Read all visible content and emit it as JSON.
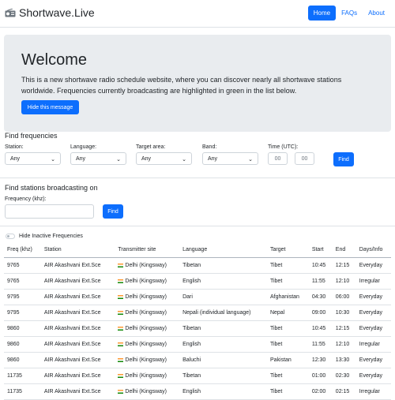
{
  "nav": {
    "brand": "Shortwave.Live",
    "links": [
      {
        "label": "Home",
        "active": true
      },
      {
        "label": "FAQs",
        "active": false
      },
      {
        "label": "About",
        "active": false
      }
    ]
  },
  "hero": {
    "title": "Welcome",
    "text": "This is a new shortwave radio schedule website, where you can discover nearly all shortwave stations worldwide. Frequencies currently broadcasting are highlighted in green in the list below.",
    "button": "Hide this message"
  },
  "find_frequencies": {
    "title": "Find frequencies",
    "station_label": "Station:",
    "station_value": "Any",
    "language_label": "Language:",
    "language_value": "Any",
    "target_label": "Target area:",
    "target_value": "Any",
    "band_label": "Band:",
    "band_value": "Any",
    "time_label": "Time (UTC):",
    "hour_placeholder": "00",
    "minute_placeholder": "00",
    "find_button": "Find"
  },
  "find_stations": {
    "title": "Find stations broadcasting on",
    "freq_label": "Frequency (khz):",
    "freq_value": "",
    "find_button": "Find"
  },
  "toggle": {
    "label": "Hide Inactive Frequencies",
    "on": false
  },
  "table": {
    "headers": [
      "Freq (khz)",
      "Station",
      "Transmitter site",
      "Language",
      "Target",
      "Start",
      "End",
      "Days/Info"
    ],
    "rows": [
      [
        "9765",
        "AIR Akashvani Ext.Sce",
        "Delhi (Kingsway)",
        "Tibetan",
        "Tibet",
        "10:45",
        "12:15",
        "Everyday"
      ],
      [
        "9765",
        "AIR Akashvani Ext.Sce",
        "Delhi (Kingsway)",
        "English",
        "Tibet",
        "11:55",
        "12:10",
        "Irregular"
      ],
      [
        "9795",
        "AIR Akashvani Ext.Sce",
        "Delhi (Kingsway)",
        "Dari",
        "Afghanistan",
        "04:30",
        "06:00",
        "Everyday"
      ],
      [
        "9795",
        "AIR Akashvani Ext.Sce",
        "Delhi (Kingsway)",
        "Nepali (individual language)",
        "Nepal",
        "09:00",
        "10:30",
        "Everyday"
      ],
      [
        "9860",
        "AIR Akashvani Ext.Sce",
        "Delhi (Kingsway)",
        "Tibetan",
        "Tibet",
        "10:45",
        "12:15",
        "Everyday"
      ],
      [
        "9860",
        "AIR Akashvani Ext.Sce",
        "Delhi (Kingsway)",
        "English",
        "Tibet",
        "11:55",
        "12:10",
        "Irregular"
      ],
      [
        "9860",
        "AIR Akashvani Ext.Sce",
        "Delhi (Kingsway)",
        "Baluchi",
        "Pakistan",
        "12:30",
        "13:30",
        "Everyday"
      ],
      [
        "11735",
        "AIR Akashvani Ext.Sce",
        "Delhi (Kingsway)",
        "Tibetan",
        "Tibet",
        "01:00",
        "02:30",
        "Everyday"
      ],
      [
        "11735",
        "AIR Akashvani Ext.Sce",
        "Delhi (Kingsway)",
        "English",
        "Tibet",
        "02:00",
        "02:15",
        "Irregular"
      ]
    ]
  },
  "colors": {
    "accent": "#0d6efd",
    "hero_bg": "#e9ecef"
  }
}
